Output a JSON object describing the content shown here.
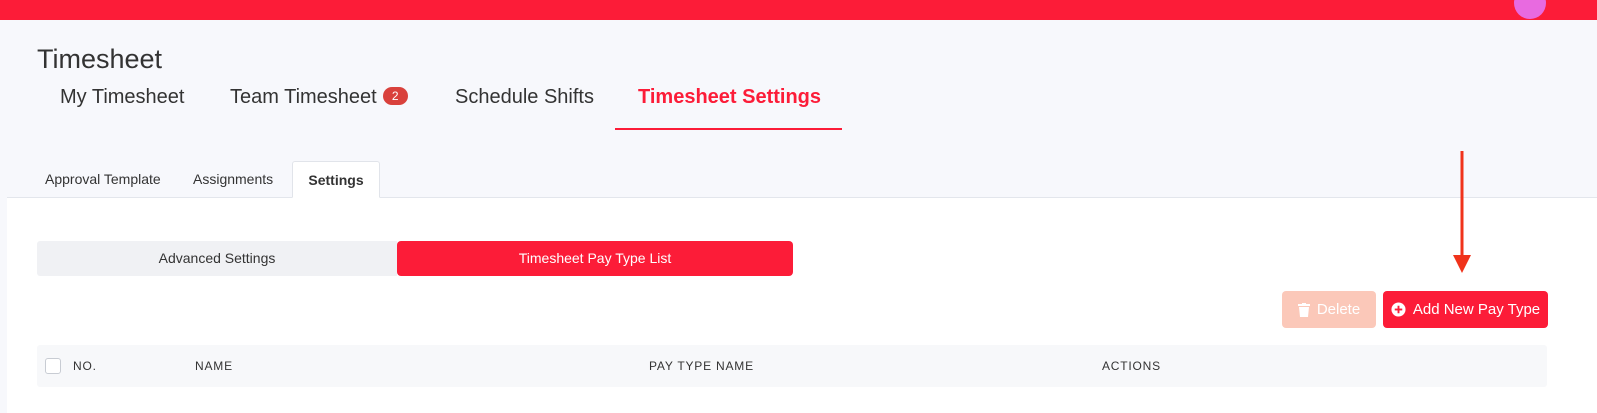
{
  "header": {
    "page_title": "Timesheet",
    "colors": {
      "brand": "#fc1c38",
      "avatar": "#e86ae0"
    }
  },
  "main_tabs": [
    {
      "label": "My Timesheet"
    },
    {
      "label": "Team Timesheet",
      "badge": "2"
    },
    {
      "label": "Schedule Shifts"
    },
    {
      "label": "Timesheet Settings",
      "active": true
    }
  ],
  "sub_tabs": [
    {
      "label": "Approval Template"
    },
    {
      "label": "Assignments"
    },
    {
      "label": "Settings",
      "active": true
    }
  ],
  "segments": [
    {
      "label": "Advanced Settings"
    },
    {
      "label": "Timesheet Pay Type List",
      "active": true
    }
  ],
  "toolbar": {
    "delete_label": "Delete",
    "add_label": "Add New Pay Type",
    "delete_icon": "trash-icon",
    "add_icon": "plus-circle-icon"
  },
  "table": {
    "columns": [
      "NO.",
      "NAME",
      "PAY TYPE NAME",
      "ACTIONS"
    ]
  }
}
